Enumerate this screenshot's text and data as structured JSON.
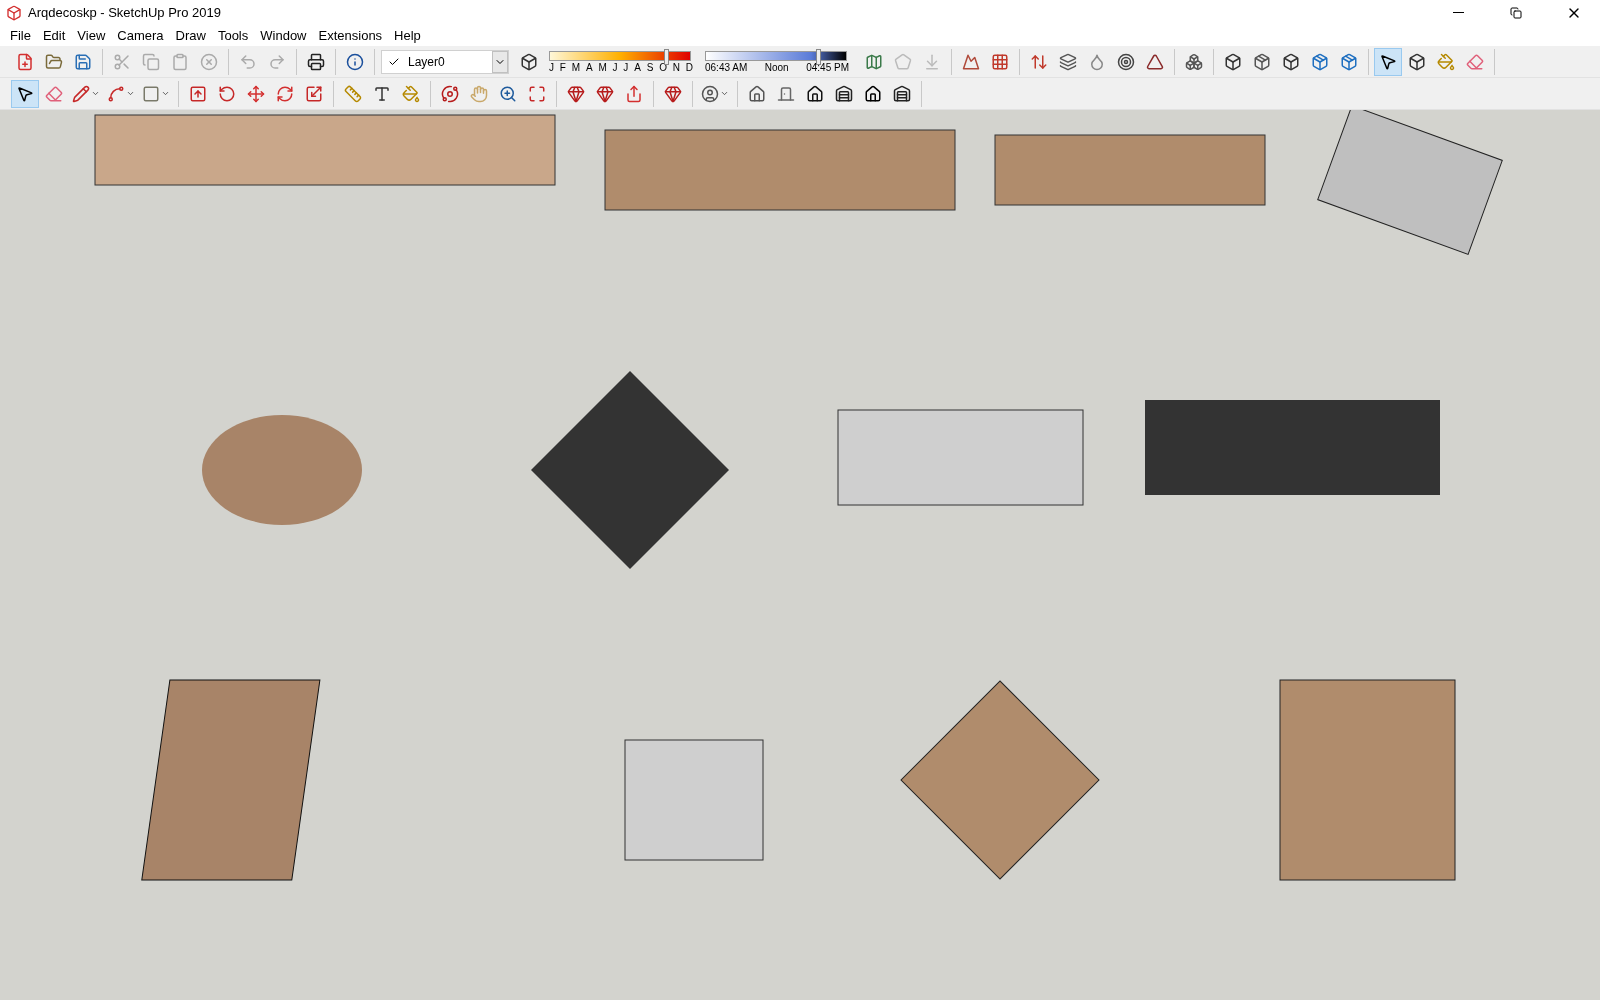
{
  "window": {
    "title": "Arqdecoskp - SketchUp Pro 2019"
  },
  "menu": [
    "File",
    "Edit",
    "View",
    "Camera",
    "Draw",
    "Tools",
    "Window",
    "Extensions",
    "Help"
  ],
  "toolbar_1": {
    "groups_left": [
      [
        {
          "kind": "file-plus",
          "selected": false
        },
        {
          "kind": "folder",
          "selected": false
        },
        {
          "kind": "save",
          "selected": false
        }
      ],
      [
        {
          "kind": "scissors",
          "selected": false
        },
        {
          "kind": "copy",
          "selected": false
        },
        {
          "kind": "clipboard",
          "selected": false
        },
        {
          "kind": "circle-x",
          "selected": false
        }
      ],
      [
        {
          "kind": "undo",
          "selected": false
        },
        {
          "kind": "redo",
          "selected": false
        }
      ],
      [
        {
          "kind": "printer",
          "selected": false
        }
      ],
      [
        {
          "kind": "info",
          "selected": false
        }
      ]
    ],
    "layer": {
      "value": "Layer0"
    },
    "shadow_toggle": {
      "kind": "box",
      "selected": false
    },
    "month_slider": {
      "level": 0.83,
      "labels": [
        "J",
        "F",
        "M",
        "A",
        "M",
        "J",
        "J",
        "A",
        "S",
        "O",
        "N",
        "D"
      ]
    },
    "time_slider": {
      "level": 0.8,
      "labels": [
        "06:43 AM",
        "Noon",
        "04:45 PM"
      ]
    },
    "groups_right": [
      [
        {
          "kind": "map",
          "selected": false
        },
        {
          "kind": "pentagon",
          "selected": false
        },
        {
          "kind": "arrow-down",
          "selected": false
        }
      ],
      [
        {
          "kind": "mountain",
          "selected": false
        },
        {
          "kind": "grid",
          "selected": false
        }
      ],
      [
        {
          "kind": "arrow-up-down",
          "selected": false
        },
        {
          "kind": "layers",
          "selected": false
        },
        {
          "kind": "droplet",
          "selected": false
        },
        {
          "kind": "target",
          "selected": false
        },
        {
          "kind": "triangle",
          "selected": false
        }
      ],
      [
        {
          "kind": "boxes",
          "selected": false
        }
      ],
      [
        {
          "kind": "box",
          "selected": false
        },
        {
          "kind": "package",
          "selected": false
        },
        {
          "kind": "box",
          "selected": false
        },
        {
          "kind": "package-blue",
          "selected": false
        },
        {
          "kind": "package-blue",
          "selected": false
        }
      ],
      [
        {
          "kind": "pointer",
          "selected": true
        },
        {
          "kind": "box",
          "selected": false
        },
        {
          "kind": "paint",
          "selected": false
        },
        {
          "kind": "eraser",
          "selected": false
        }
      ]
    ]
  },
  "toolbar_2": [
    [
      {
        "kind": "pointer",
        "selected": true
      },
      {
        "kind": "eraser",
        "selected": false
      },
      {
        "kind": "pencil",
        "selected": false,
        "menu": true
      },
      {
        "kind": "arc",
        "selected": false,
        "menu": true
      },
      {
        "kind": "square",
        "selected": false,
        "menu": true
      }
    ],
    [
      {
        "kind": "arrow-up-square",
        "selected": false
      },
      {
        "kind": "rotate-ccw",
        "selected": false
      },
      {
        "kind": "move",
        "selected": false
      },
      {
        "kind": "refresh",
        "selected": false
      },
      {
        "kind": "scale",
        "selected": false
      }
    ],
    [
      {
        "kind": "ruler",
        "selected": false
      },
      {
        "kind": "type",
        "selected": false
      },
      {
        "kind": "paint",
        "selected": false
      }
    ],
    [
      {
        "kind": "orbit",
        "selected": false
      },
      {
        "kind": "hand",
        "selected": false
      },
      {
        "kind": "zoom",
        "selected": false
      },
      {
        "kind": "maximize",
        "selected": false
      }
    ],
    [
      {
        "kind": "gem",
        "selected": false
      },
      {
        "kind": "gem",
        "selected": false
      },
      {
        "kind": "share",
        "selected": false
      }
    ],
    [
      {
        "kind": "gem",
        "selected": false
      }
    ],
    [
      {
        "kind": "user",
        "selected": false,
        "menu": true
      }
    ],
    [
      {
        "kind": "house",
        "selected": false
      },
      {
        "kind": "door",
        "selected": false
      },
      {
        "kind": "home",
        "selected": false
      },
      {
        "kind": "warehouse",
        "selected": false
      },
      {
        "kind": "house-outline",
        "selected": false
      },
      {
        "kind": "warehouse",
        "selected": false
      }
    ]
  ]
}
